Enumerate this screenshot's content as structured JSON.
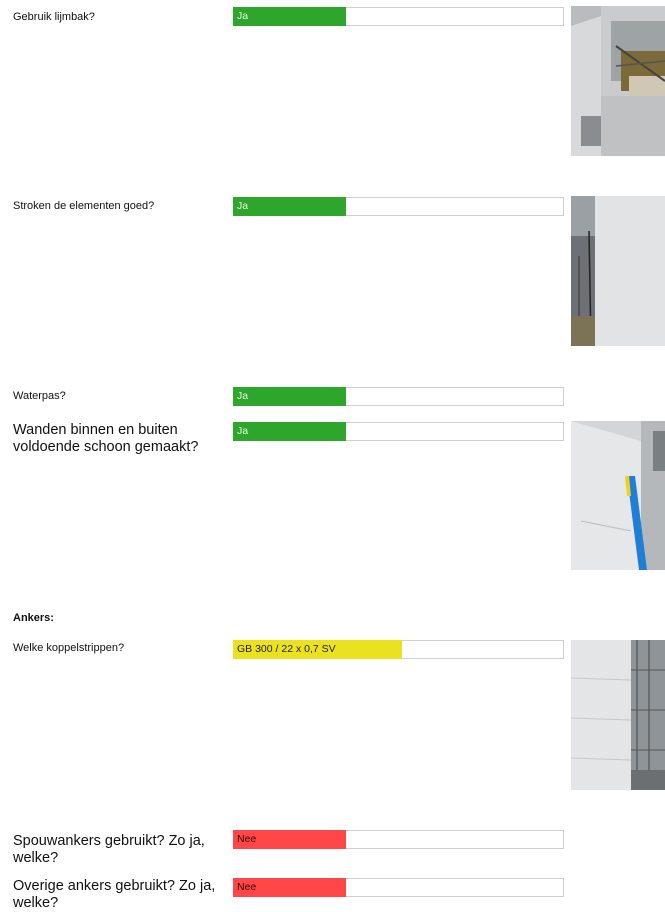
{
  "items": [
    {
      "question": "Gebruik lijmbak?",
      "answer": "Ja",
      "status": "green"
    },
    {
      "question": "Stroken de elementen goed?",
      "answer": "Ja",
      "status": "green"
    },
    {
      "question": "Waterpas?",
      "answer": "Ja",
      "status": "green"
    },
    {
      "question": "Wanden binnen en buiten voldoende schoon gemaakt?",
      "answer": "Ja",
      "status": "green"
    },
    {
      "question": "Welke koppelstrippen?",
      "answer": "GB 300 / 22 x 0,7 SV",
      "status": "yellow"
    },
    {
      "question": "Spouwankers gebruikt? Zo ja, welke?",
      "answer": "Nee",
      "status": "red"
    },
    {
      "question": "Overige ankers gebruikt? Zo ja, welke?",
      "answer": "Nee",
      "status": "red"
    }
  ],
  "section_ankers": "Ankers:",
  "colors": {
    "green": "#2ea52b",
    "yellow": "#ece11e",
    "red": "#ff4747"
  },
  "photos": [
    "construction-site-photo",
    "wall-photo",
    "wall-level-photo",
    "wall-corner-photo"
  ]
}
